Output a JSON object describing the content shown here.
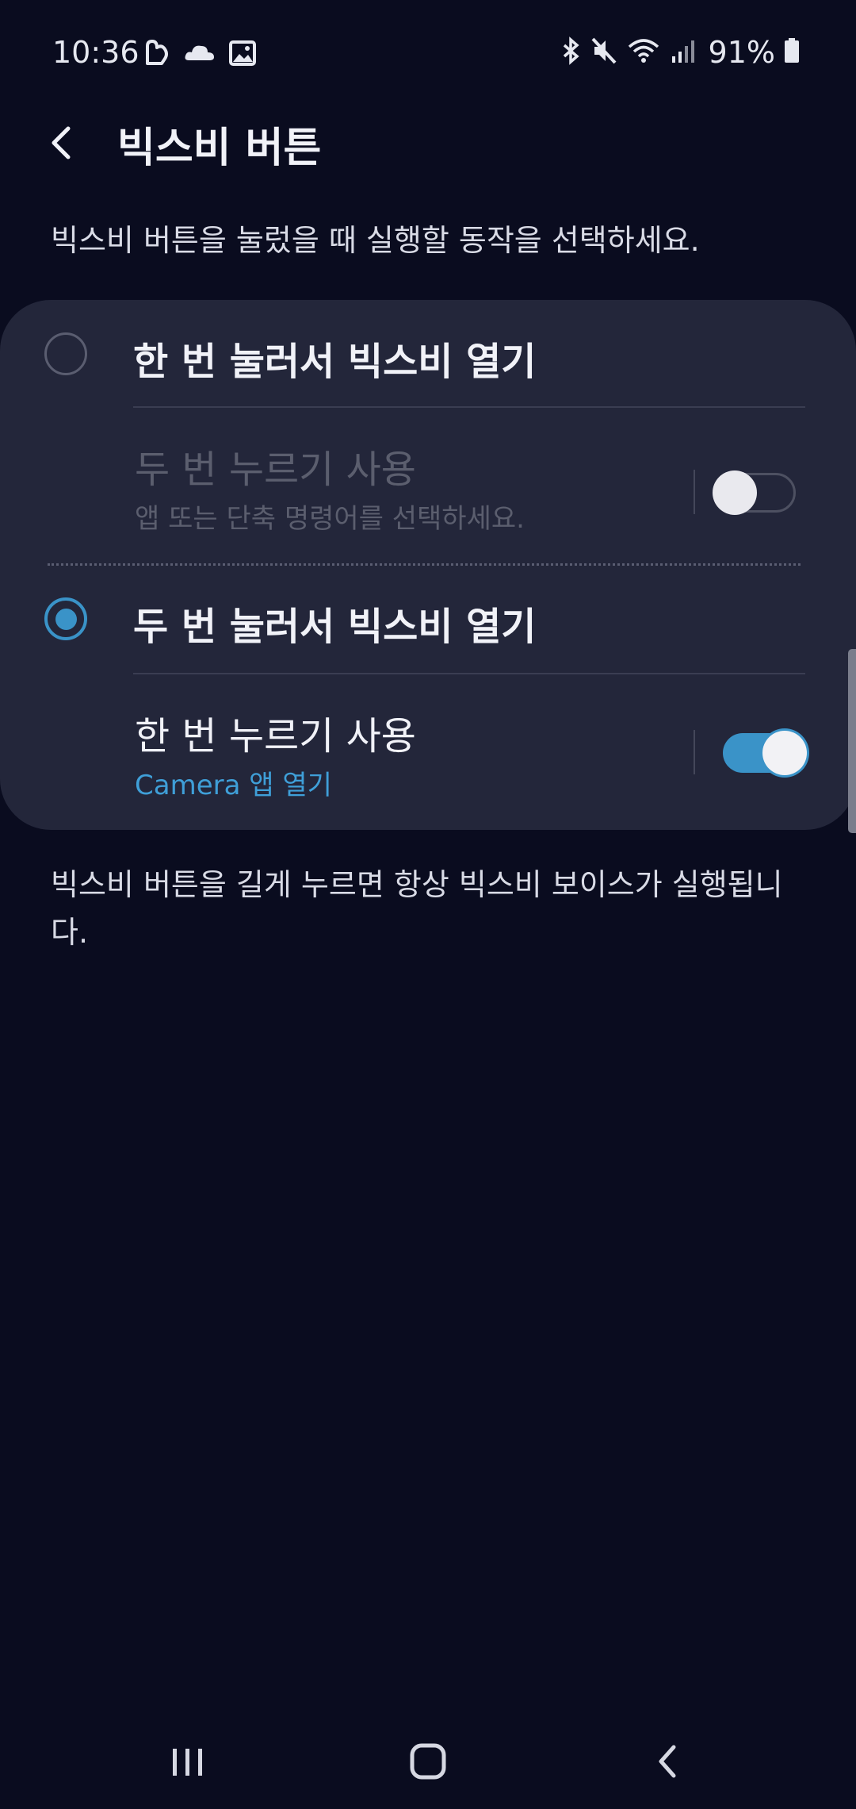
{
  "status": {
    "time": "10:36",
    "battery": "91%",
    "left_icons": [
      "sync-icon",
      "cloud-icon",
      "gallery-icon"
    ],
    "right_icons": [
      "bluetooth-icon",
      "mute-icon",
      "wifi-icon",
      "signal-icon",
      "battery-icon"
    ]
  },
  "header": {
    "title": "빅스비 버튼",
    "back_icon": "back-arrow-icon"
  },
  "description": "빅스비 버튼을 눌렀을 때 실행할 동작을 선택하세요.",
  "options": [
    {
      "label": "한 번 눌러서 빅스비 열기",
      "selected": false,
      "sub": {
        "title": "두 번 누르기 사용",
        "desc": "앱 또는 단축 명령어를 선택하세요.",
        "enabled": false,
        "toggle_on": false
      }
    },
    {
      "label": "두 번 눌러서 빅스비 열기",
      "selected": true,
      "sub": {
        "title": "한 번 누르기 사용",
        "desc": "Camera 앱 열기",
        "enabled": true,
        "toggle_on": true
      }
    }
  ],
  "footer_note": "빅스비 버튼을 길게 누르면 항상 빅스비 보이스가 실행됩니다.",
  "colors": {
    "accent": "#3a93c8",
    "background": "#0a0c1f",
    "card": "#23263a"
  },
  "navbar": [
    "recent-apps-icon",
    "home-icon",
    "back-icon"
  ]
}
